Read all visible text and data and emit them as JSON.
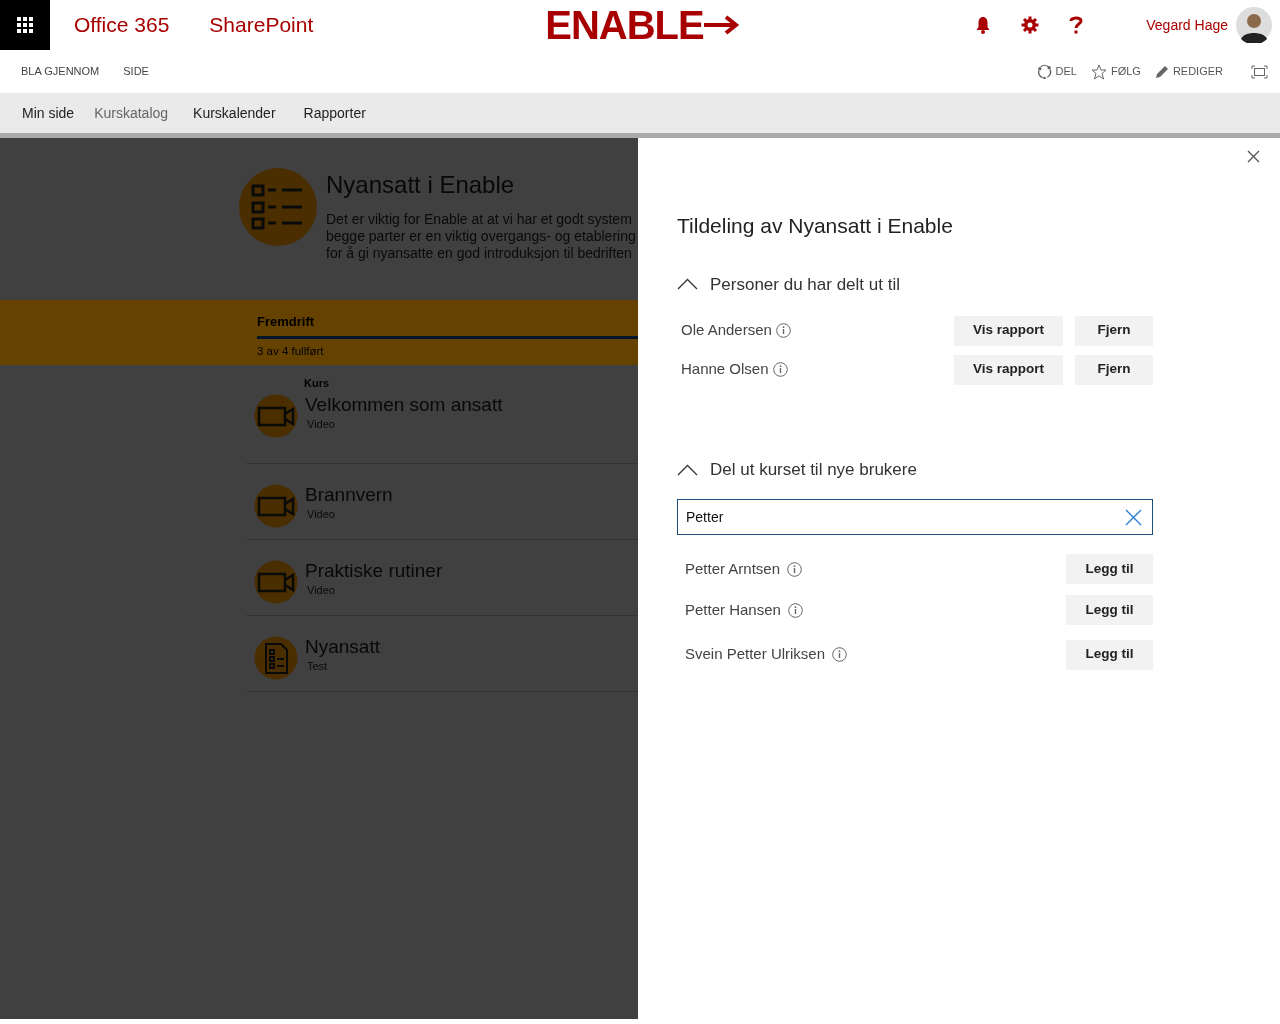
{
  "suite_bar": {
    "brand": "Office 365",
    "app": "SharePoint",
    "logo_text": "ENABLE",
    "user_name": "Vegard Hage"
  },
  "ribbon": {
    "tabs": [
      "BLA GJENNOM",
      "SIDE"
    ],
    "actions": [
      {
        "label": "DEL",
        "kind": "share"
      },
      {
        "label": "FØLG",
        "kind": "follow"
      },
      {
        "label": "REDIGER",
        "kind": "edit"
      }
    ]
  },
  "top_nav": [
    {
      "label": "Min side",
      "selected": false
    },
    {
      "label": "Kurskatalog",
      "selected": true
    },
    {
      "label": "Kurskalender",
      "selected": false
    },
    {
      "label": "Rapporter",
      "selected": false
    }
  ],
  "course": {
    "title": "Nyansatt i Enable",
    "description_lines": [
      "Det er viktig for Enable at at vi har et godt system",
      "begge parter er en viktig overgangs- og etablering",
      "for å gi nyansatte en god introduksjon til bedriften"
    ],
    "progress": {
      "label": "Fremdrift",
      "status": "3 av 4 fullført"
    },
    "list_heading": "Kurs",
    "items": [
      {
        "title": "Velkommen som ansatt",
        "type": "Video",
        "kind": "video"
      },
      {
        "title": "Brannvern",
        "type": "Video",
        "kind": "video"
      },
      {
        "title": "Praktiske rutiner",
        "type": "Video",
        "kind": "video"
      },
      {
        "title": "Nyansatt",
        "type": "Test",
        "kind": "test"
      }
    ]
  },
  "panel": {
    "title": "Tildeling av Nyansatt i Enable",
    "shared_section": {
      "heading": "Personer du har delt ut til",
      "expanded": true,
      "people": [
        {
          "name": "Ole Andersen",
          "buttons": [
            "Vis rapport",
            "Fjern"
          ]
        },
        {
          "name": "Hanne Olsen",
          "buttons": [
            "Vis rapport",
            "Fjern"
          ]
        }
      ]
    },
    "add_section": {
      "heading": "Del ut kurset til nye brukere",
      "expanded": true,
      "search": {
        "value": "Petter"
      },
      "results": [
        {
          "name": "Petter Arntsen",
          "button": "Legg til"
        },
        {
          "name": "Petter Hansen",
          "button": "Legg til"
        },
        {
          "name": "Svein Petter Ulriksen",
          "button": "Legg til"
        }
      ]
    }
  }
}
